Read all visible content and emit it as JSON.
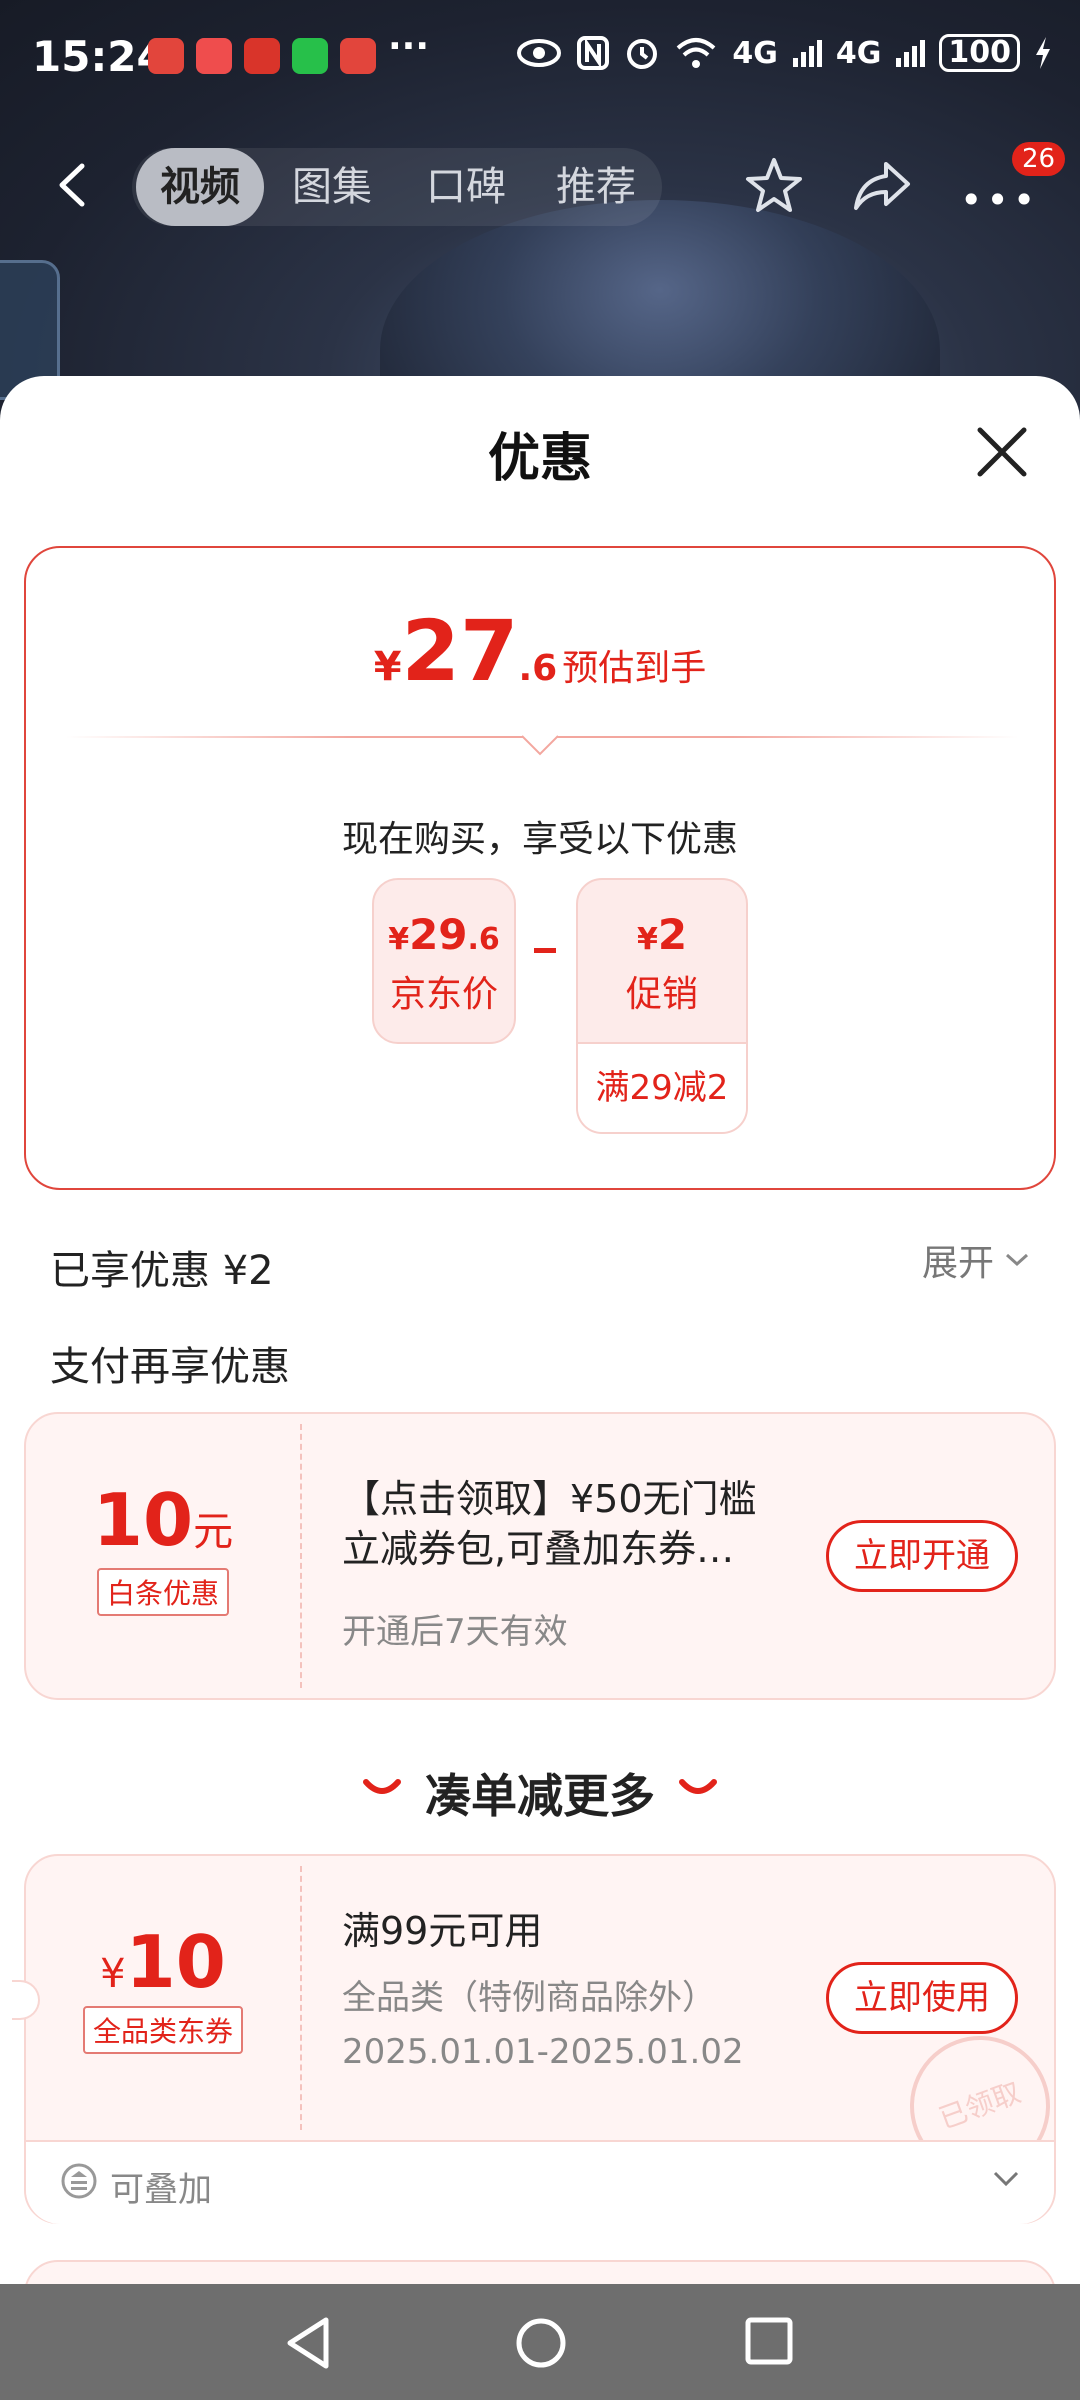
{
  "status_bar": {
    "time": "15:24",
    "more": "···",
    "network1": "4G",
    "network2": "4G",
    "battery": "100"
  },
  "nav": {
    "tabs": [
      "视频",
      "图集",
      "口碑",
      "推荐"
    ],
    "active_tab": 0,
    "badge_count": "26"
  },
  "sheet": {
    "title": "优惠",
    "estimate": {
      "currency": "¥",
      "integer": "27",
      "decimal": ".6",
      "label": "预估到手"
    },
    "buy_now_text": "现在购买，享受以下优惠",
    "price_card": {
      "currency": "¥",
      "integer": "29",
      "decimal": ".6",
      "label": "京东价"
    },
    "promo_card": {
      "currency": "¥",
      "value": "2",
      "label": "促销",
      "detail": "满29减2"
    },
    "enjoyed_text": "已享优惠 ¥2",
    "expand_text": "展开",
    "pay_title": "支付再享优惠",
    "coupon1": {
      "amount": "10",
      "unit": "元",
      "tag": "白条优惠",
      "title": "【点击领取】¥50无门槛立减券包,可叠加东券…",
      "title_line1": "【点击领取】¥50无门槛",
      "title_line2": "立减券包,可叠加东券…",
      "sub": "开通后7天有效",
      "button": "立即开通"
    },
    "more_title": "凑单减更多",
    "coupon2": {
      "currency": "¥",
      "amount": "10",
      "tag": "全品类东券",
      "title": "满99元可用",
      "sub": "全品类（特例商品除外）",
      "date": "2025.01.01-2025.01.02",
      "button": "立即使用",
      "stamp": "已领取",
      "stack_label": "可叠加"
    }
  },
  "colors": {
    "accent": "#e2231a",
    "light_bg": "#fff4f3",
    "nav_bar": "#6e6e6e"
  }
}
